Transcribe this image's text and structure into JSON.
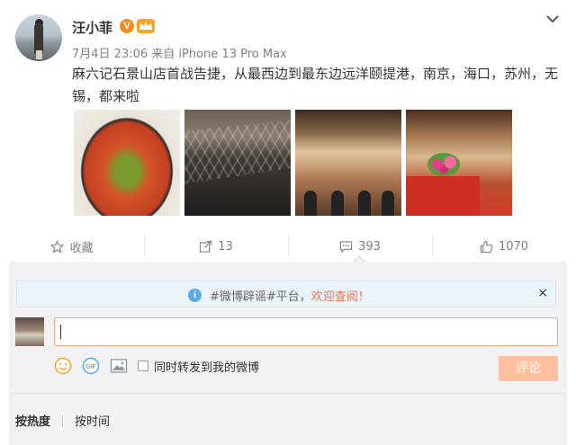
{
  "post": {
    "author": "汪小菲",
    "verified_badge": "V",
    "vip_badge": "会员",
    "meta": "7月4日 23:06 来自 iPhone 13 Pro Max",
    "text": "麻六记石景山店首战告捷，从最西边到最东边远洋颐提港，南京，海口，苏州，无锡，都来啦",
    "images": [
      "food-dish-photo",
      "ceiling-architecture-photo",
      "restaurant-interior-photo",
      "restaurant-counter-photo"
    ]
  },
  "actions": {
    "favorite": "收藏",
    "repost_count": "13",
    "comment_count": "393",
    "like_count": "1070"
  },
  "comments": {
    "notice_prefix": "#微博辟谣#平台，",
    "notice_link": "欢迎查阅！",
    "close": "×",
    "input_value": "",
    "repost_checkbox_label": "同时转发到我的微博",
    "submit_label": "评论",
    "sort_hot": "按热度",
    "sort_time": "按时间"
  },
  "colors": {
    "accent_orange": "#eb7350",
    "submit_disabled": "#ffc09f",
    "info_blue": "#5aa9e6"
  }
}
